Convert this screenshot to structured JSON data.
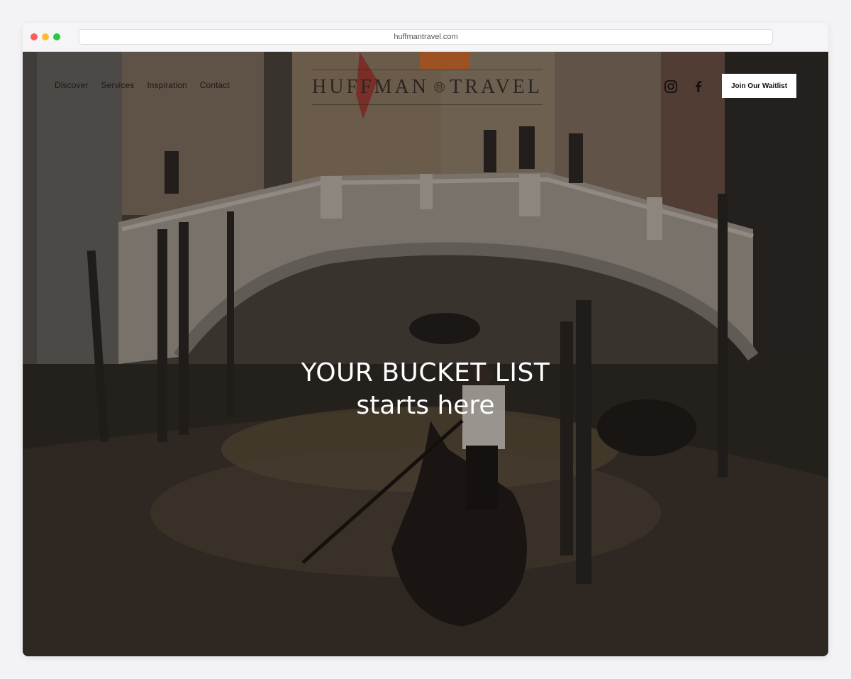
{
  "browser": {
    "url": "huffmantravel.com"
  },
  "nav": {
    "items": [
      "Discover",
      "Services",
      "Inspiration",
      "Contact"
    ]
  },
  "logo": {
    "left": "HUFFMAN",
    "right": "TRAVEL"
  },
  "social": {
    "instagram": "instagram-icon",
    "facebook": "facebook-icon"
  },
  "cta": {
    "label": "Join Our Waitlist"
  },
  "hero": {
    "headline_line1": "YOUR BUCKET LIST",
    "headline_line2": "starts here"
  },
  "colors": {
    "cta_bg": "#ffffff",
    "headline": "#ffffff",
    "nav_text": "#1e1a17"
  }
}
